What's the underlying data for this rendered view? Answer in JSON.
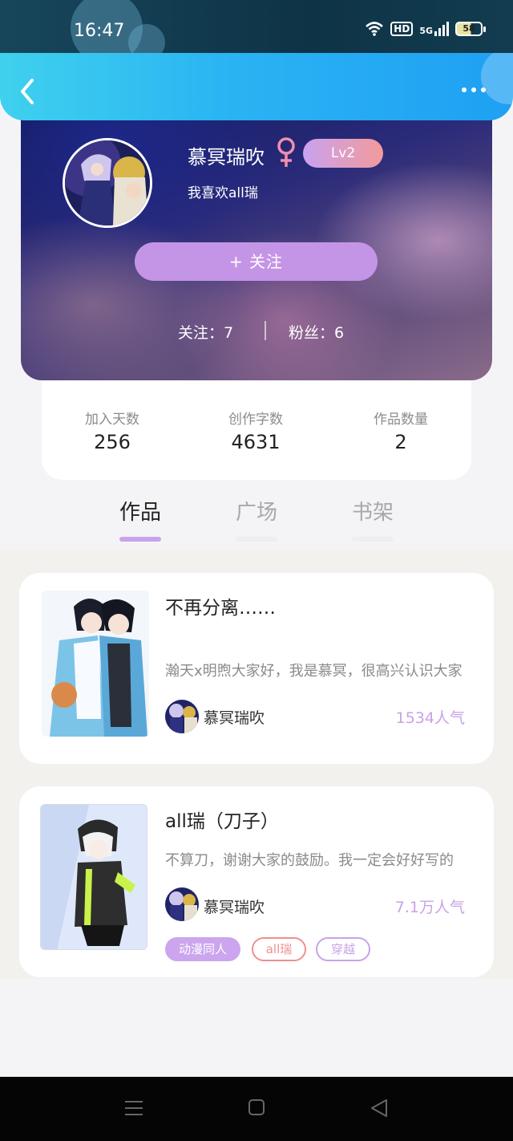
{
  "status_bar": {
    "time": "16:47",
    "hd": "HD",
    "network": "5G",
    "battery": "58"
  },
  "header": {
    "back_icon": "chevron-left-icon",
    "more_icon": "more-dots-icon"
  },
  "profile": {
    "username": "慕冥瑞吹",
    "gender_icon": "female-icon",
    "gender_color": "#f08fae",
    "level": "Lv2",
    "bio": "我喜欢all瑞",
    "follow_label": "+  关注",
    "following_text": "关注：7",
    "fans_text": "粉丝：6"
  },
  "stats": [
    {
      "label": "加入天数",
      "value": "256"
    },
    {
      "label": "创作字数",
      "value": "4631"
    },
    {
      "label": "作品数量",
      "value": "2"
    }
  ],
  "tabs": [
    {
      "label": "作品",
      "active": true
    },
    {
      "label": "广场",
      "active": false
    },
    {
      "label": "书架",
      "active": false
    }
  ],
  "works": [
    {
      "title": "不再分离……",
      "description": "瀚天x明煦大家好，我是慕冥，很高兴认识大家",
      "author": "慕冥瑞吹",
      "popularity": "1534人气",
      "tags": []
    },
    {
      "title": "all瑞（刀子）",
      "description": "不算刀，谢谢大家的鼓励。我一定会好好写的",
      "author": "慕冥瑞吹",
      "popularity": "7.1万人气",
      "tags": [
        "动漫同人",
        "all瑞",
        "穿越"
      ]
    }
  ],
  "nav_bar": {
    "menu_icon": "menu-icon",
    "home_icon": "home-square-icon",
    "back_icon": "back-triangle-icon"
  },
  "colors": {
    "accent": "#c495e6",
    "header": "#2ab3f3",
    "popularity": "#c9a2e8"
  }
}
